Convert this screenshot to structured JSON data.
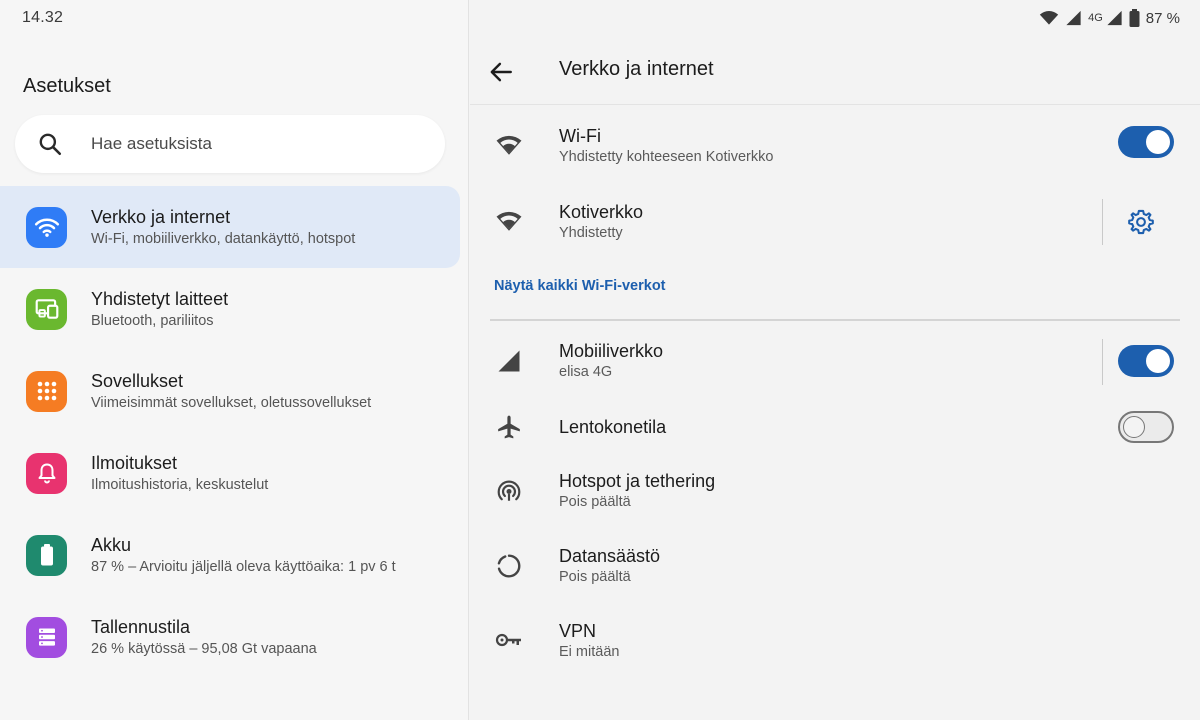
{
  "status_bar": {
    "time": "14.32",
    "network_label": "4G",
    "battery": "87 %",
    "icons": [
      "wifi-icon",
      "signal-icon",
      "signal-icon",
      "battery-icon"
    ]
  },
  "left": {
    "title": "Asetukset",
    "search_placeholder": "Hae asetuksista",
    "categories": [
      {
        "title": "Verkko ja internet",
        "subtitle": "Wi-Fi, mobiiliverkko, datankäyttö, hotspot",
        "icon": "wifi-icon",
        "color": "#2f7cf6",
        "selected": true
      },
      {
        "title": "Yhdistetyt laitteet",
        "subtitle": "Bluetooth, pariliitos",
        "icon": "devices-icon",
        "color": "#6ab82f"
      },
      {
        "title": "Sovellukset",
        "subtitle": "Viimeisimmät sovellukset, oletussovellukset",
        "icon": "apps-icon",
        "color": "#f57c23"
      },
      {
        "title": "Ilmoitukset",
        "subtitle": "Ilmoitushistoria, keskustelut",
        "icon": "bell-icon",
        "color": "#e8336f"
      },
      {
        "title": "Akku",
        "subtitle": "87 % – Arvioitu jäljellä oleva käyttöaika: 1 pv 6 t",
        "icon": "battery-icon",
        "color": "#1f8a6e"
      },
      {
        "title": "Tallennustila",
        "subtitle": "26 % käytössä – 95,08 Gt vapaana",
        "icon": "storage-icon",
        "color": "#a24de0"
      }
    ]
  },
  "right": {
    "title": "Verkko ja internet",
    "wifi": {
      "title": "Wi-Fi",
      "subtitle": "Yhdistetty kohteeseen Kotiverkko",
      "enabled": true
    },
    "network": {
      "title": "Kotiverkko",
      "subtitle": "Yhdistetty"
    },
    "show_all_link": "Näytä kaikki Wi-Fi-verkot",
    "mobile": {
      "title": "Mobiiliverkko",
      "subtitle": "elisa 4G",
      "enabled": true
    },
    "airplane": {
      "title": "Lentokonetila",
      "enabled": false
    },
    "hotspot": {
      "title": "Hotspot ja tethering",
      "subtitle": "Pois päältä"
    },
    "datasaver": {
      "title": "Datansäästö",
      "subtitle": "Pois päältä"
    },
    "vpn": {
      "title": "VPN",
      "subtitle": "Ei mitään"
    }
  },
  "colors": {
    "accent": "#1d5fae",
    "selected_bg": "#e0e9f7"
  }
}
